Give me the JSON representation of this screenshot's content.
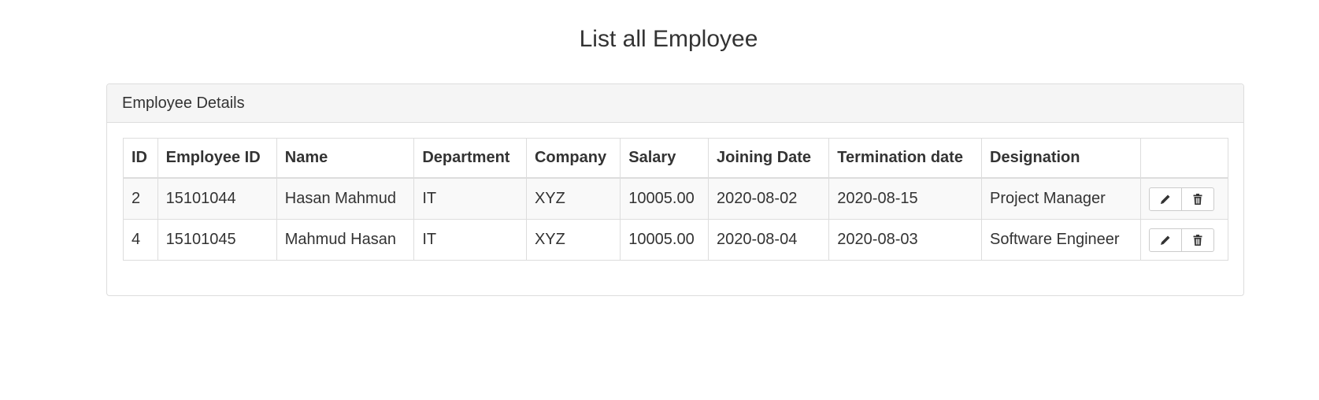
{
  "page": {
    "title": "List all Employee"
  },
  "panel": {
    "heading": "Employee Details"
  },
  "table": {
    "columns": [
      "ID",
      "Employee ID",
      "Name",
      "Department",
      "Company",
      "Salary",
      "Joining Date",
      "Termination date",
      "Designation",
      ""
    ],
    "rows": [
      {
        "id": "2",
        "employee_id": "15101044",
        "name": "Hasan Mahmud",
        "department": "IT",
        "company": "XYZ",
        "salary": "10005.00",
        "joining_date": "2020-08-02",
        "termination_date": "2020-08-15",
        "designation": "Project Manager"
      },
      {
        "id": "4",
        "employee_id": "15101045",
        "name": "Mahmud Hasan",
        "department": "IT",
        "company": "XYZ",
        "salary": "10005.00",
        "joining_date": "2020-08-04",
        "termination_date": "2020-08-03",
        "designation": "Software Engineer"
      }
    ],
    "actions": [
      {
        "icon": "pencil-icon"
      },
      {
        "icon": "trash-icon"
      }
    ]
  }
}
